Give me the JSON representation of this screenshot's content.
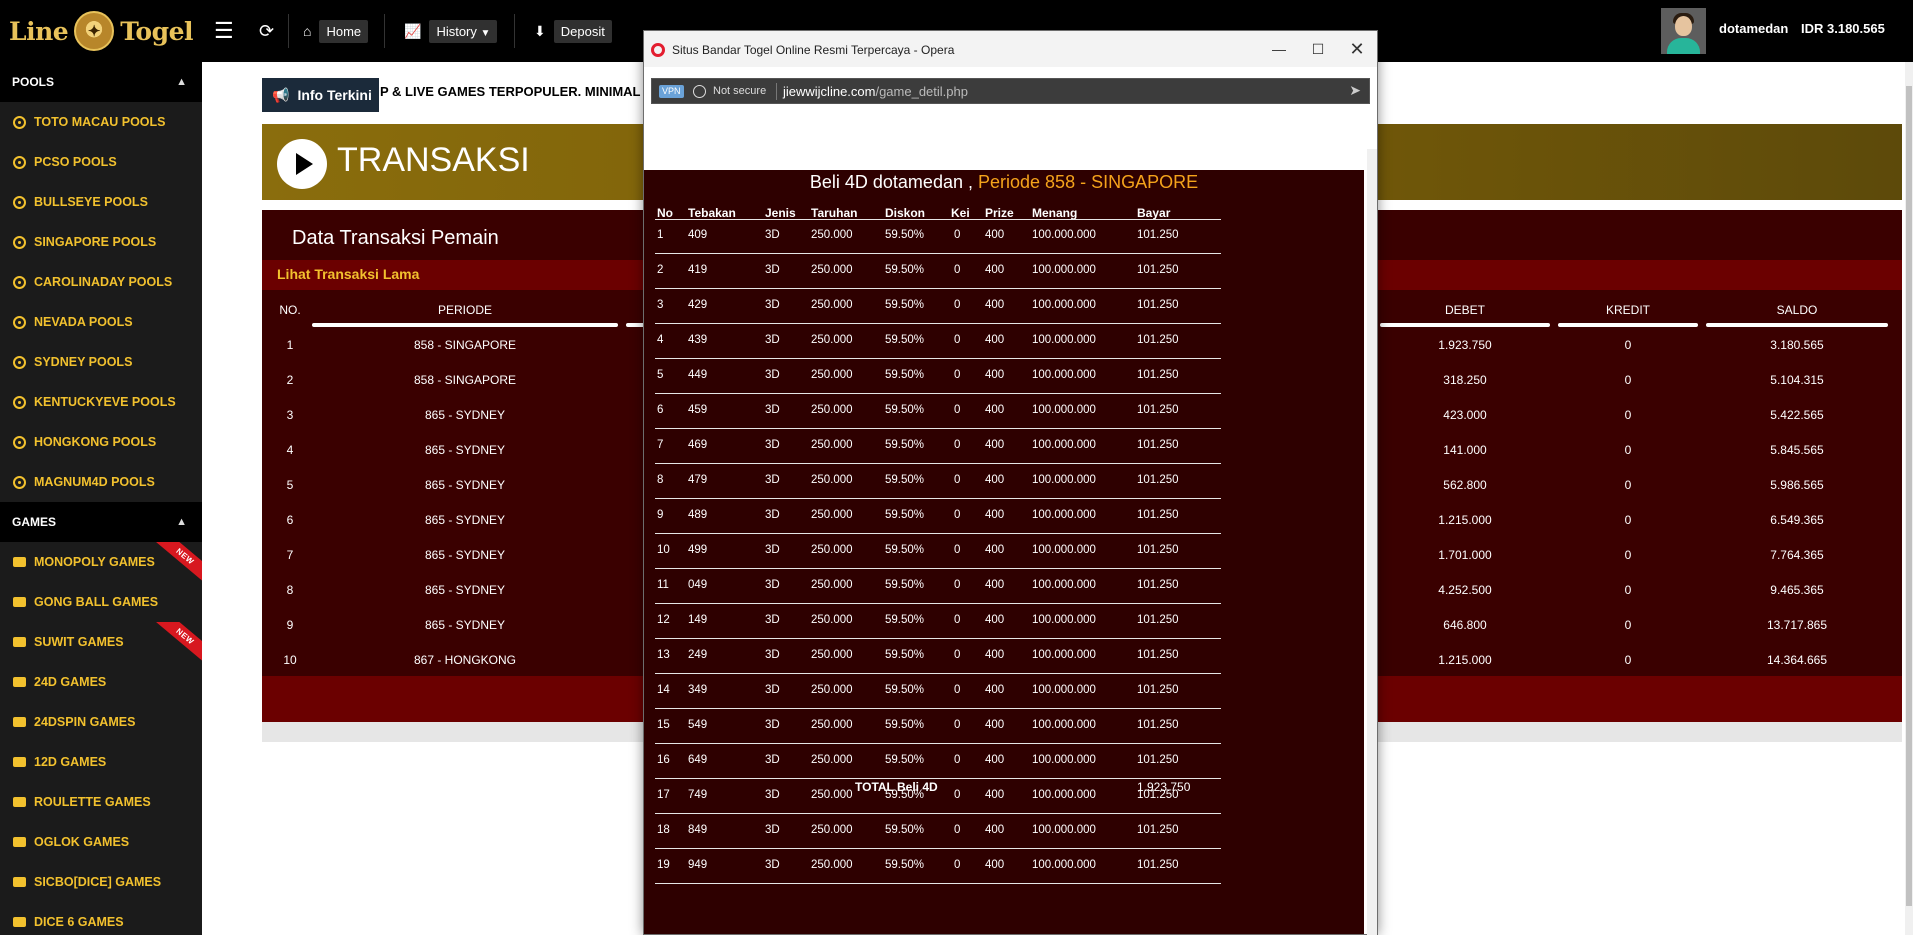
{
  "brand": {
    "logo_text": "LineTogel"
  },
  "topnav": {
    "home": "Home",
    "history": "History",
    "deposit": "Deposit",
    "username": "dotamedan",
    "balance": "IDR 3.180.565"
  },
  "sidebar": {
    "pools_header": "POOLS",
    "pools": [
      "TOTO MACAU POOLS",
      "PCSO POOLS",
      "BULLSEYE POOLS",
      "SINGAPORE POOLS",
      "CAROLINADAY POOLS",
      "NEVADA POOLS",
      "SYDNEY POOLS",
      "KENTUCKYEVE POOLS",
      "HONGKONG POOLS",
      "MAGNUM4D POOLS"
    ],
    "games_header": "GAMES",
    "games": [
      {
        "label": "MONOPOLY GAMES",
        "badge": "NEW"
      },
      {
        "label": "GONG BALL GAMES",
        "badge": ""
      },
      {
        "label": "SUWIT GAMES",
        "badge": "NEW"
      },
      {
        "label": "24D GAMES",
        "badge": ""
      },
      {
        "label": "24DSPIN GAMES",
        "badge": ""
      },
      {
        "label": "12D GAMES",
        "badge": ""
      },
      {
        "label": "ROULETTE GAMES",
        "badge": ""
      },
      {
        "label": "OGLOK GAMES",
        "badge": ""
      },
      {
        "label": "SICBO[DICE] GAMES",
        "badge": ""
      },
      {
        "label": "DICE 6 GAMES",
        "badge": ""
      }
    ]
  },
  "main": {
    "info_button": "Info Terkini",
    "marquee": "P & LIVE GAMES TERPOPULER. MINIMAL D",
    "banner_title": "TRANSAKSI",
    "data_title": "Data Transaksi Pemain",
    "old_trans_link": "Lihat Transaksi Lama",
    "columns": {
      "no": "NO.",
      "periode": "PERIODE",
      "debet": "DEBET",
      "kredit": "KREDIT",
      "saldo": "SALDO"
    },
    "rows": [
      {
        "no": "1",
        "periode": "858 - SINGAPORE",
        "debet": "1.923.750",
        "kredit": "0",
        "saldo": "3.180.565"
      },
      {
        "no": "2",
        "periode": "858 - SINGAPORE",
        "debet": "318.250",
        "kredit": "0",
        "saldo": "5.104.315"
      },
      {
        "no": "3",
        "periode": "865 - SYDNEY",
        "debet": "423.000",
        "kredit": "0",
        "saldo": "5.422.565"
      },
      {
        "no": "4",
        "periode": "865 - SYDNEY",
        "debet": "141.000",
        "kredit": "0",
        "saldo": "5.845.565"
      },
      {
        "no": "5",
        "periode": "865 - SYDNEY",
        "debet": "562.800",
        "kredit": "0",
        "saldo": "5.986.565"
      },
      {
        "no": "6",
        "periode": "865 - SYDNEY",
        "debet": "1.215.000",
        "kredit": "0",
        "saldo": "6.549.365"
      },
      {
        "no": "7",
        "periode": "865 - SYDNEY",
        "debet": "1.701.000",
        "kredit": "0",
        "saldo": "7.764.365"
      },
      {
        "no": "8",
        "periode": "865 - SYDNEY",
        "debet": "4.252.500",
        "kredit": "0",
        "saldo": "9.465.365"
      },
      {
        "no": "9",
        "periode": "865 - SYDNEY",
        "debet": "646.800",
        "kredit": "0",
        "saldo": "13.717.865"
      },
      {
        "no": "10",
        "periode": "867 - HONGKONG",
        "debet": "1.215.000",
        "kredit": "0",
        "saldo": "14.364.665"
      }
    ]
  },
  "popup": {
    "window_title": "Situs Bandar Togel Online Resmi Terpercaya - Opera",
    "vpn": "VPN",
    "not_secure": "Not secure",
    "url_host": "jiewwijcline.com",
    "url_path": "/game_detil.php",
    "bet_title_white": "Beli 4D dotamedan ,",
    "bet_title_orange": "Periode 858 - SINGAPORE",
    "columns": {
      "no": "No",
      "tebakan": "Tebakan",
      "jenis": "Jenis",
      "taruhan": "Taruhan",
      "diskon": "Diskon",
      "kei": "Kei",
      "prize": "Prize",
      "menang": "Menang",
      "bayar": "Bayar"
    },
    "bets": [
      {
        "no": "1",
        "tebakan": "409",
        "jenis": "3D",
        "taruhan": "250.000",
        "diskon": "59.50%",
        "kei": "0",
        "prize": "400",
        "menang": "100.000.000",
        "bayar": "101.250"
      },
      {
        "no": "2",
        "tebakan": "419",
        "jenis": "3D",
        "taruhan": "250.000",
        "diskon": "59.50%",
        "kei": "0",
        "prize": "400",
        "menang": "100.000.000",
        "bayar": "101.250"
      },
      {
        "no": "3",
        "tebakan": "429",
        "jenis": "3D",
        "taruhan": "250.000",
        "diskon": "59.50%",
        "kei": "0",
        "prize": "400",
        "menang": "100.000.000",
        "bayar": "101.250"
      },
      {
        "no": "4",
        "tebakan": "439",
        "jenis": "3D",
        "taruhan": "250.000",
        "diskon": "59.50%",
        "kei": "0",
        "prize": "400",
        "menang": "100.000.000",
        "bayar": "101.250"
      },
      {
        "no": "5",
        "tebakan": "449",
        "jenis": "3D",
        "taruhan": "250.000",
        "diskon": "59.50%",
        "kei": "0",
        "prize": "400",
        "menang": "100.000.000",
        "bayar": "101.250"
      },
      {
        "no": "6",
        "tebakan": "459",
        "jenis": "3D",
        "taruhan": "250.000",
        "diskon": "59.50%",
        "kei": "0",
        "prize": "400",
        "menang": "100.000.000",
        "bayar": "101.250"
      },
      {
        "no": "7",
        "tebakan": "469",
        "jenis": "3D",
        "taruhan": "250.000",
        "diskon": "59.50%",
        "kei": "0",
        "prize": "400",
        "menang": "100.000.000",
        "bayar": "101.250"
      },
      {
        "no": "8",
        "tebakan": "479",
        "jenis": "3D",
        "taruhan": "250.000",
        "diskon": "59.50%",
        "kei": "0",
        "prize": "400",
        "menang": "100.000.000",
        "bayar": "101.250"
      },
      {
        "no": "9",
        "tebakan": "489",
        "jenis": "3D",
        "taruhan": "250.000",
        "diskon": "59.50%",
        "kei": "0",
        "prize": "400",
        "menang": "100.000.000",
        "bayar": "101.250"
      },
      {
        "no": "10",
        "tebakan": "499",
        "jenis": "3D",
        "taruhan": "250.000",
        "diskon": "59.50%",
        "kei": "0",
        "prize": "400",
        "menang": "100.000.000",
        "bayar": "101.250"
      },
      {
        "no": "11",
        "tebakan": "049",
        "jenis": "3D",
        "taruhan": "250.000",
        "diskon": "59.50%",
        "kei": "0",
        "prize": "400",
        "menang": "100.000.000",
        "bayar": "101.250"
      },
      {
        "no": "12",
        "tebakan": "149",
        "jenis": "3D",
        "taruhan": "250.000",
        "diskon": "59.50%",
        "kei": "0",
        "prize": "400",
        "menang": "100.000.000",
        "bayar": "101.250"
      },
      {
        "no": "13",
        "tebakan": "249",
        "jenis": "3D",
        "taruhan": "250.000",
        "diskon": "59.50%",
        "kei": "0",
        "prize": "400",
        "menang": "100.000.000",
        "bayar": "101.250"
      },
      {
        "no": "14",
        "tebakan": "349",
        "jenis": "3D",
        "taruhan": "250.000",
        "diskon": "59.50%",
        "kei": "0",
        "prize": "400",
        "menang": "100.000.000",
        "bayar": "101.250"
      },
      {
        "no": "15",
        "tebakan": "549",
        "jenis": "3D",
        "taruhan": "250.000",
        "diskon": "59.50%",
        "kei": "0",
        "prize": "400",
        "menang": "100.000.000",
        "bayar": "101.250"
      },
      {
        "no": "16",
        "tebakan": "649",
        "jenis": "3D",
        "taruhan": "250.000",
        "diskon": "59.50%",
        "kei": "0",
        "prize": "400",
        "menang": "100.000.000",
        "bayar": "101.250"
      },
      {
        "no": "17",
        "tebakan": "749",
        "jenis": "3D",
        "taruhan": "250.000",
        "diskon": "59.50%",
        "kei": "0",
        "prize": "400",
        "menang": "100.000.000",
        "bayar": "101.250"
      },
      {
        "no": "18",
        "tebakan": "849",
        "jenis": "3D",
        "taruhan": "250.000",
        "diskon": "59.50%",
        "kei": "0",
        "prize": "400",
        "menang": "100.000.000",
        "bayar": "101.250"
      },
      {
        "no": "19",
        "tebakan": "949",
        "jenis": "3D",
        "taruhan": "250.000",
        "diskon": "59.50%",
        "kei": "0",
        "prize": "400",
        "menang": "100.000.000",
        "bayar": "101.250"
      }
    ],
    "total_label": "TOTAL  Beli 4D",
    "total_value": "1.923.750"
  },
  "colors": {
    "gold": "#f2c12e",
    "maroon": "#3a0000",
    "red_bar": "#6b0000",
    "orange": "#f5a31b",
    "ribbon": "#d7181f"
  }
}
